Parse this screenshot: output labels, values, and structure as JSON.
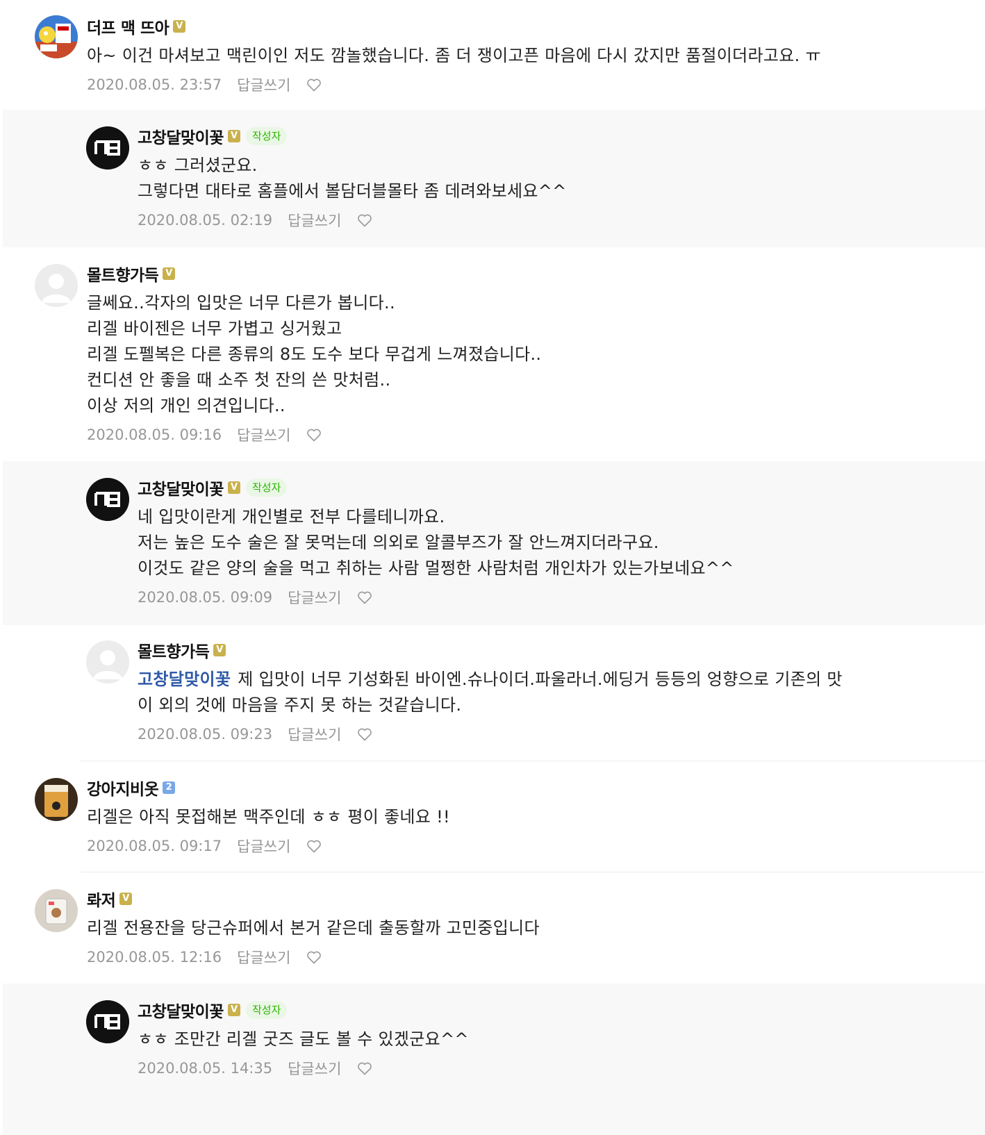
{
  "reply_label": "답글쓰기",
  "author_tag": "작성자",
  "comments": [
    {
      "nick": "더프 맥 뜨아",
      "badge": "V",
      "lines": [
        "아~ 이건 마셔보고 맥린이인 저도 깜놀했습니다. 좀 더 쟁이고픈 마음에 다시 갔지만 품절이더라고요. ㅠ"
      ],
      "date": "2020.08.05. 23:57",
      "avatar": "cartoon"
    },
    {
      "nick": "고창달맞이꽃",
      "badge": "V",
      "author": true,
      "lines": [
        "ㅎㅎ 그러셨군요.",
        "그렇다면 대타로 홈플에서 볼담더블몰타 좀 데려와보세요^^"
      ],
      "date": "2020.08.05. 02:19",
      "avatar": "logo"
    },
    {
      "nick": "몰트향가득",
      "badge": "V",
      "lines": [
        "글쎄요..각자의 입맛은 너무 다른가 봅니다..",
        "리겔 바이젠은 너무 가볍고 싱거웠고",
        "리겔 도펠복은 다른 종류의 8도 도수 보다 무겁게 느껴졌습니다..",
        "컨디션 안 좋을 때 소주 첫 잔의 쓴 맛처럼..",
        "이상 저의 개인 의견입니다.."
      ],
      "date": "2020.08.05. 09:16",
      "avatar": "blank"
    },
    {
      "nick": "고창달맞이꽃",
      "badge": "V",
      "author": true,
      "lines": [
        "네 입맛이란게 개인별로 전부 다를테니까요.",
        "저는 높은 도수 술은 잘 못먹는데 의외로 알콜부즈가 잘 안느껴지더라구요.",
        "이것도 같은 양의 술을 먹고 취하는 사람 멀쩡한 사람처럼 개인차가 있는가보네요^^"
      ],
      "date": "2020.08.05. 09:09",
      "avatar": "logo"
    },
    {
      "nick": "몰트향가득",
      "badge": "V",
      "mention": "고창달맞이꽃",
      "lines": [
        "제 입맛이 너무 기성화된 바이엔.슈나이더.파울라너.에딩거 등등의 엉향으로 기존의 맛",
        "이 외의 것에 마음을 주지 못 하는 것같습니다."
      ],
      "date": "2020.08.05. 09:23",
      "avatar": "blank"
    },
    {
      "nick": "강아지비옷",
      "badge": "2",
      "lines": [
        "리겔은 아직 못접해본 맥주인데 ㅎㅎ 평이 좋네요 !!"
      ],
      "date": "2020.08.05. 09:17",
      "avatar": "beer"
    },
    {
      "nick": "롸저",
      "badge": "V",
      "lines": [
        "리겔 전용잔을 당근슈퍼에서 본거 같은데 출동할까 고민중입니다"
      ],
      "date": "2020.08.05. 12:16",
      "avatar": "mug"
    },
    {
      "nick": "고창달맞이꽃",
      "badge": "V",
      "author": true,
      "lines": [
        "ㅎㅎ 조만간 리겔 굿즈 글도 볼 수 있겠군요^^"
      ],
      "date": "2020.08.05. 14:35",
      "avatar": "logo"
    }
  ]
}
